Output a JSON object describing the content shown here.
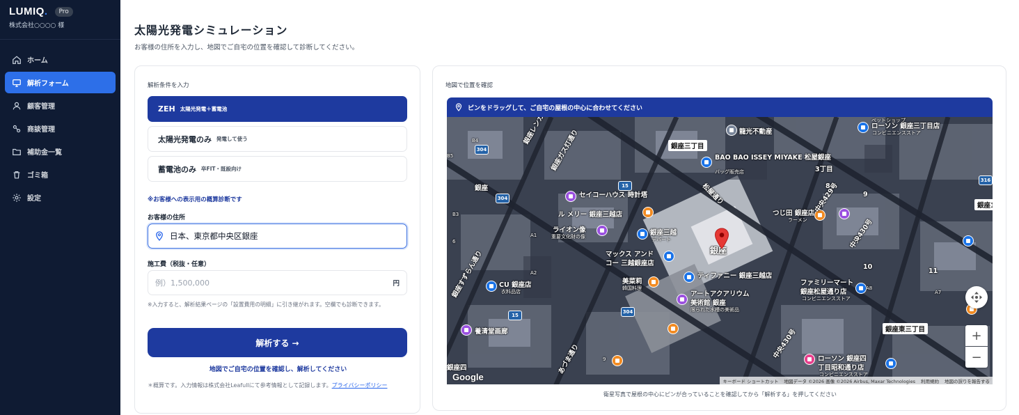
{
  "brand": {
    "logo": "LUMIQ",
    "logo_dot": ".",
    "badge": "Pro",
    "company": "株式会社○○○○ 様"
  },
  "nav": [
    {
      "label": "ホーム",
      "icon": "home-icon",
      "active": false
    },
    {
      "label": "解析フォーム",
      "icon": "monitor-icon",
      "active": true
    },
    {
      "label": "顧客管理",
      "icon": "user-icon",
      "active": false
    },
    {
      "label": "商談管理",
      "icon": "handshake-icon",
      "active": false
    },
    {
      "label": "補助金一覧",
      "icon": "folder-icon",
      "active": false
    },
    {
      "label": "ゴミ箱",
      "icon": "trash-icon",
      "active": false
    },
    {
      "label": "設定",
      "icon": "gear-icon",
      "active": false
    }
  ],
  "page": {
    "title": "太陽光発電シミュレーション",
    "subtitle": "お客様の住所を入力し、地図でご自宅の位置を確認して診断してください。"
  },
  "form": {
    "section_label": "解析条件を入力",
    "options": [
      {
        "main": "ZEH",
        "sub": "太陽光発電＋蓄電池",
        "selected": true
      },
      {
        "main": "太陽光発電のみ",
        "sub": "発電して使う",
        "selected": false
      },
      {
        "main": "蓄電池のみ",
        "sub": "卒FIT・既設向け",
        "selected": false
      }
    ],
    "note": "※お客様への表示用の概算診断です",
    "address_label": "お客様の住所",
    "address_value": "日本、東京都中央区銀座",
    "cost_label": "施工費（税抜・任意）",
    "cost_placeholder": "例）1,500,000",
    "cost_unit": "円",
    "help": "※入力すると、解析結果ページの「設置費用の明細」に引き継がれます。空欄でも診断できます。",
    "submit": "解析する →",
    "confirm_link": "地図でご自宅の位置を確認し、解析してください",
    "disclaimer": "＊概算です。入力情報は株式会社Leafullにて参考情報として記録します。",
    "privacy": "プライバシーポリシー"
  },
  "map": {
    "section_label": "地図で位置を確認",
    "banner": "ピンをドラッグして、ご自宅の屋根の中心に合わせてください",
    "caption": "衛星写真で屋根の中心にピンが合っていることを確認してから「解析する」を押してください",
    "google": "Google",
    "attribution": [
      "キーボード ショートカット",
      "地図データ ©2026 画像 ©2026 Airbus, Maxar Technologies",
      "利用規約",
      "地図の誤りを報告する"
    ],
    "zoom_in": "+",
    "zoom_out": "−",
    "street_labels": [
      "銀座三丁目",
      "銀座東三丁目",
      "銀座1"
    ],
    "labels": {
      "ryuko": "龍光不動産",
      "baobao": "BAO BAO ISSEY MIYAKE 松屋銀座",
      "baobao_sub": "バッグ販売店",
      "lawson1": "ローソン 銀座三丁目店",
      "lawson1_sub": "コンビニエンスストア",
      "seiko": "セイコーハウス 時計塔",
      "mitsukoshi": "ル メリー 銀座三越店",
      "lion": "ライオン像",
      "lion_sub": "重要文化財の像",
      "ginzamitsukoshi": "銀座三越",
      "ginzamitsukoshi_sub": "デパート",
      "max": "マックス アンド",
      "max2": "コー 三越銀座店",
      "tiffany": "ティファニー 銀座三越店",
      "mikuni": "美菜莉",
      "mikuni_sub": "韓国料理",
      "artaqua": "アートアクアリウム",
      "artaqua2": "美術館 銀座",
      "artaqua_sub": "限られた水槽の美術品",
      "tsujita": "つじ田 銀座店",
      "tsujita_sub": "ラーメン",
      "famima": "ファミリーマート",
      "famima2": "銀座松屋通り店",
      "famima_sub": "コンビニエンスストア",
      "cu": "CU 銀座店",
      "cu_sub": "衣料品店",
      "yojo": "養清堂画廊",
      "lawson2": "ローソン 銀座四",
      "lawson2b": "丁目昭和通り店",
      "lawson2_sub": "コンビニエンスストア",
      "ginza": "銀座",
      "ginza_station": "銀座",
      "matsuya": "松屋通り",
      "chuo429": "中央429号",
      "chuo430": "中央430号",
      "chuo430b": "中央430号",
      "ginzagas": "銀座ガス灯通り",
      "ginzasuzuran": "銀座すずらん通り",
      "azuma": "あづま通り",
      "ginzarenga": "銀座レンガ",
      "sanchome": "3丁目",
      "pet": "ペットショップ",
      "ginzafour": "銀座四"
    },
    "numbers": [
      "6",
      "9",
      "A1",
      "A2",
      "A7",
      "A8",
      "B3",
      "B4",
      "B5",
      "11",
      "9",
      "9",
      "10",
      "8"
    ],
    "shields": [
      "304",
      "15",
      "304",
      "15",
      "304",
      "316"
    ]
  }
}
